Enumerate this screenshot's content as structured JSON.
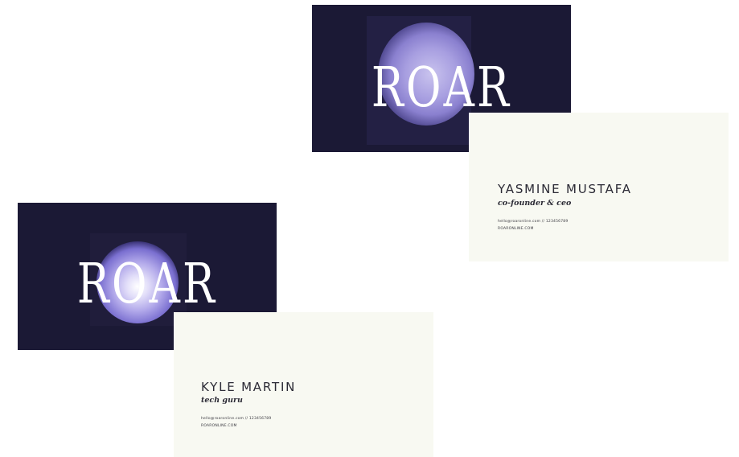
{
  "colors": {
    "card_front_bg": "#1b1935",
    "card_back_bg": "#f8f9f2",
    "flower_accent": "#8a80cf",
    "text_dark": "#2b2a35"
  },
  "cards": [
    {
      "logo": "ROAR",
      "name": "YASMINE MUSTAFA",
      "title": "co-founder & ceo",
      "contact_line_1": "hello@roaronline.com // 123456789",
      "contact_line_2": "ROARONLINE.COM"
    },
    {
      "logo": "ROAR",
      "name": "KYLE MARTIN",
      "title": "tech guru",
      "contact_line_1": "hello@roaronline.com // 123456789",
      "contact_line_2": "ROARONLINE.COM"
    }
  ]
}
